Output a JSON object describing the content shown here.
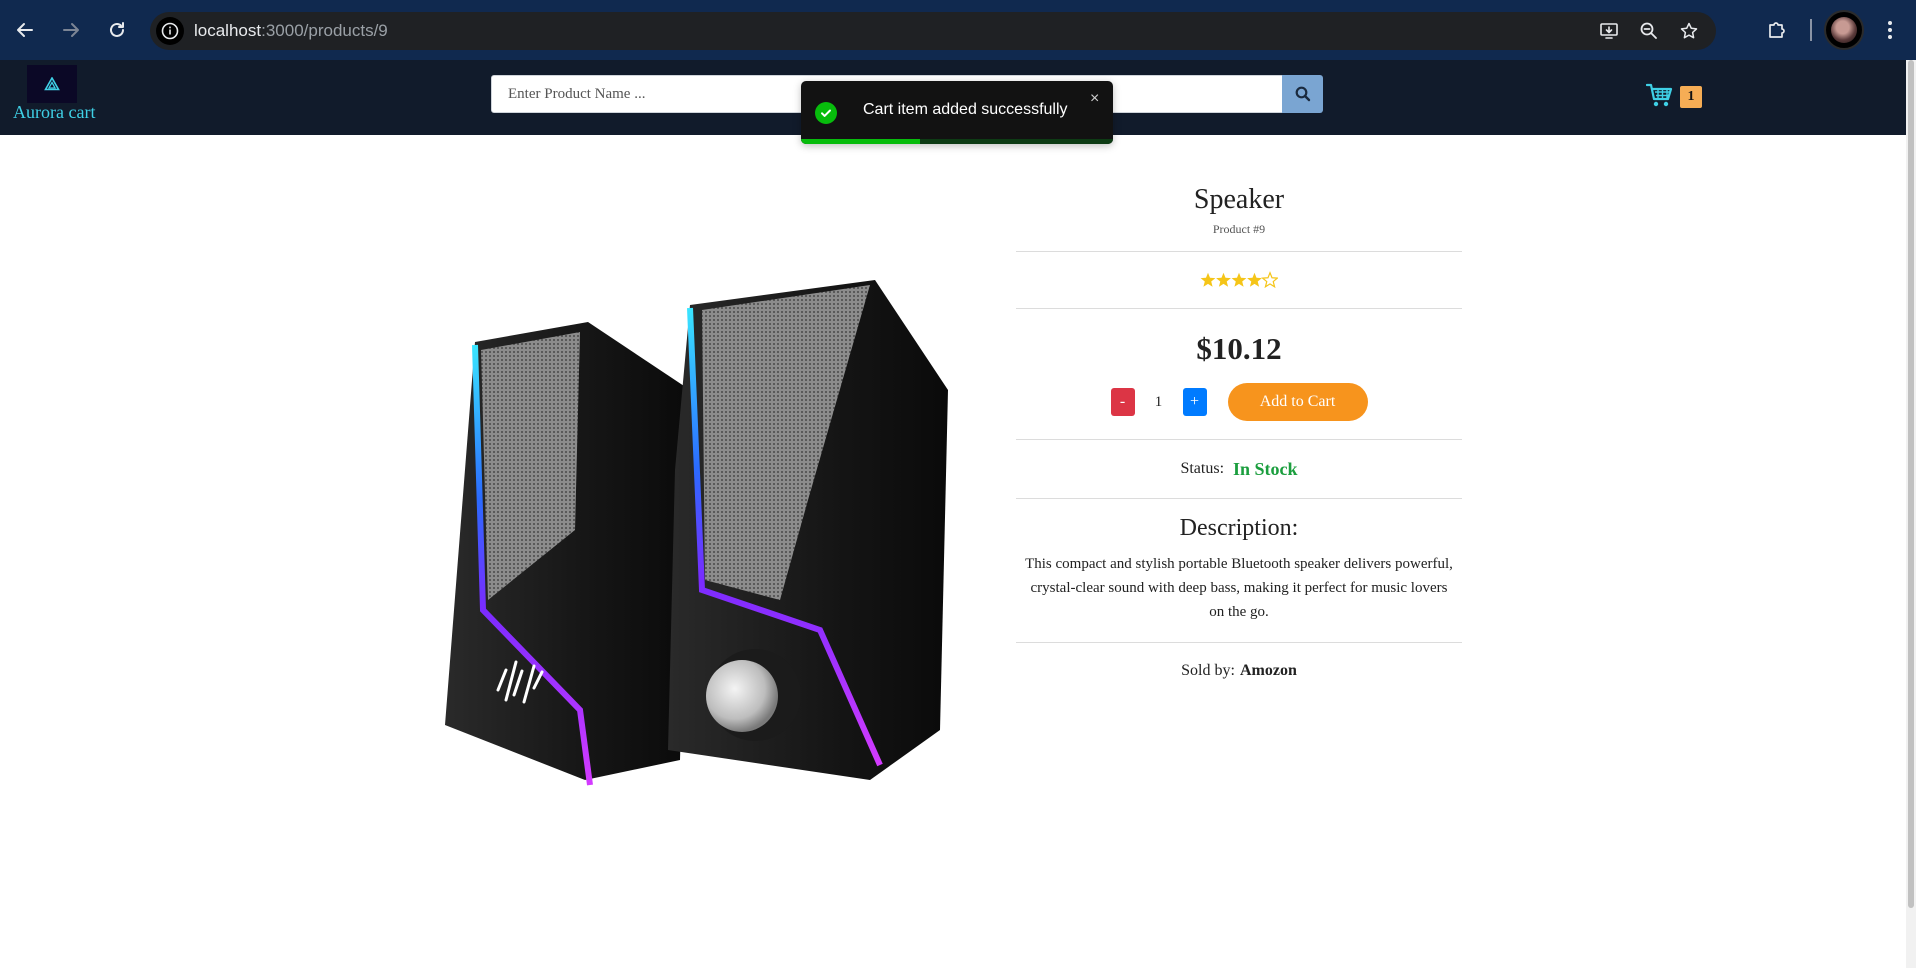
{
  "browser": {
    "url_host": "localhost",
    "url_path": ":3000/products/9"
  },
  "header": {
    "logo_text": "Aurora cart",
    "search_placeholder": "Enter Product Name ...",
    "cart_count": "1"
  },
  "toast": {
    "message": "Cart item added successfully",
    "close_label": "×",
    "progress": 0.38
  },
  "product": {
    "name": "Speaker",
    "id_label": "Product #9",
    "rating": 4,
    "rating_max": 5,
    "price": "$10.12",
    "qty_minus_label": "-",
    "quantity": "1",
    "qty_plus_label": "+",
    "add_to_cart_label": "Add to Cart",
    "status_label": "Status:",
    "status_value": "In Stock",
    "description_title": "Description:",
    "description": "This compact and stylish portable Bluetooth speaker delivers powerful, crystal-clear sound with deep bass, making it perfect for music lovers on the go.",
    "sold_by_label": "Sold by:",
    "seller": "Amozon"
  },
  "colors": {
    "header_bg": "#111b2b",
    "accent_orange": "#f7941d",
    "in_stock_green": "#1b9e3e",
    "toast_success": "#07bc0c",
    "star_gold": "#f5c518"
  },
  "icons": {
    "back": "arrow-left-icon",
    "forward": "arrow-right-icon",
    "reload": "reload-icon",
    "site_info": "info-icon",
    "install": "install-app-icon",
    "zoom": "zoom-icon",
    "bookmark": "star-icon",
    "extensions": "puzzle-icon",
    "menu": "kebab-menu-icon",
    "search": "search-icon",
    "cart": "cart-icon",
    "success": "check-circle-icon"
  }
}
